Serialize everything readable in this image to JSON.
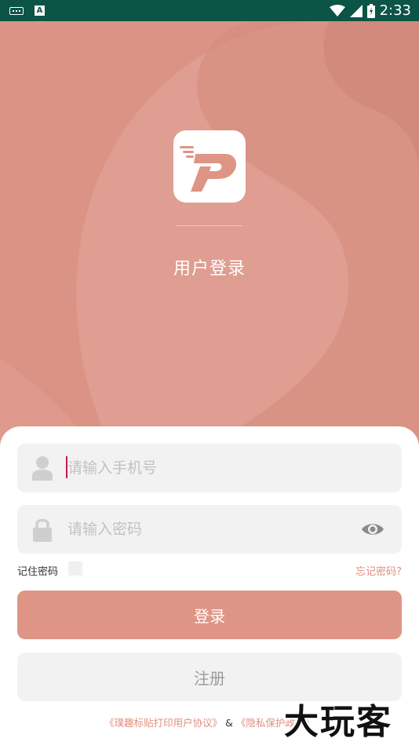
{
  "status_bar": {
    "time": "2:33",
    "background": "#0c5446"
  },
  "hero": {
    "background": "#db9385",
    "title": "用户登录"
  },
  "form": {
    "phone_placeholder": "请输入手机号",
    "password_placeholder": "请输入密码",
    "remember_label": "记住密码",
    "remember_checked": false,
    "forgot_label": "忘记密码?",
    "login_label": "登录",
    "register_label": "注册"
  },
  "agreement": {
    "user_agreement": "《璞趣标贴打印用户协议》",
    "separator": "&",
    "privacy_policy": "《隐私保护政策》"
  },
  "watermark": {
    "text": "大玩客"
  },
  "colors": {
    "accent": "#df9586",
    "link": "#e08f7f",
    "field_bg": "#f2f2f2"
  },
  "icons": [
    "keyboard-icon",
    "a-badge-icon",
    "wifi-icon",
    "signal-icon",
    "battery-icon",
    "user-icon",
    "lock-icon",
    "eye-icon",
    "app-logo-icon"
  ]
}
